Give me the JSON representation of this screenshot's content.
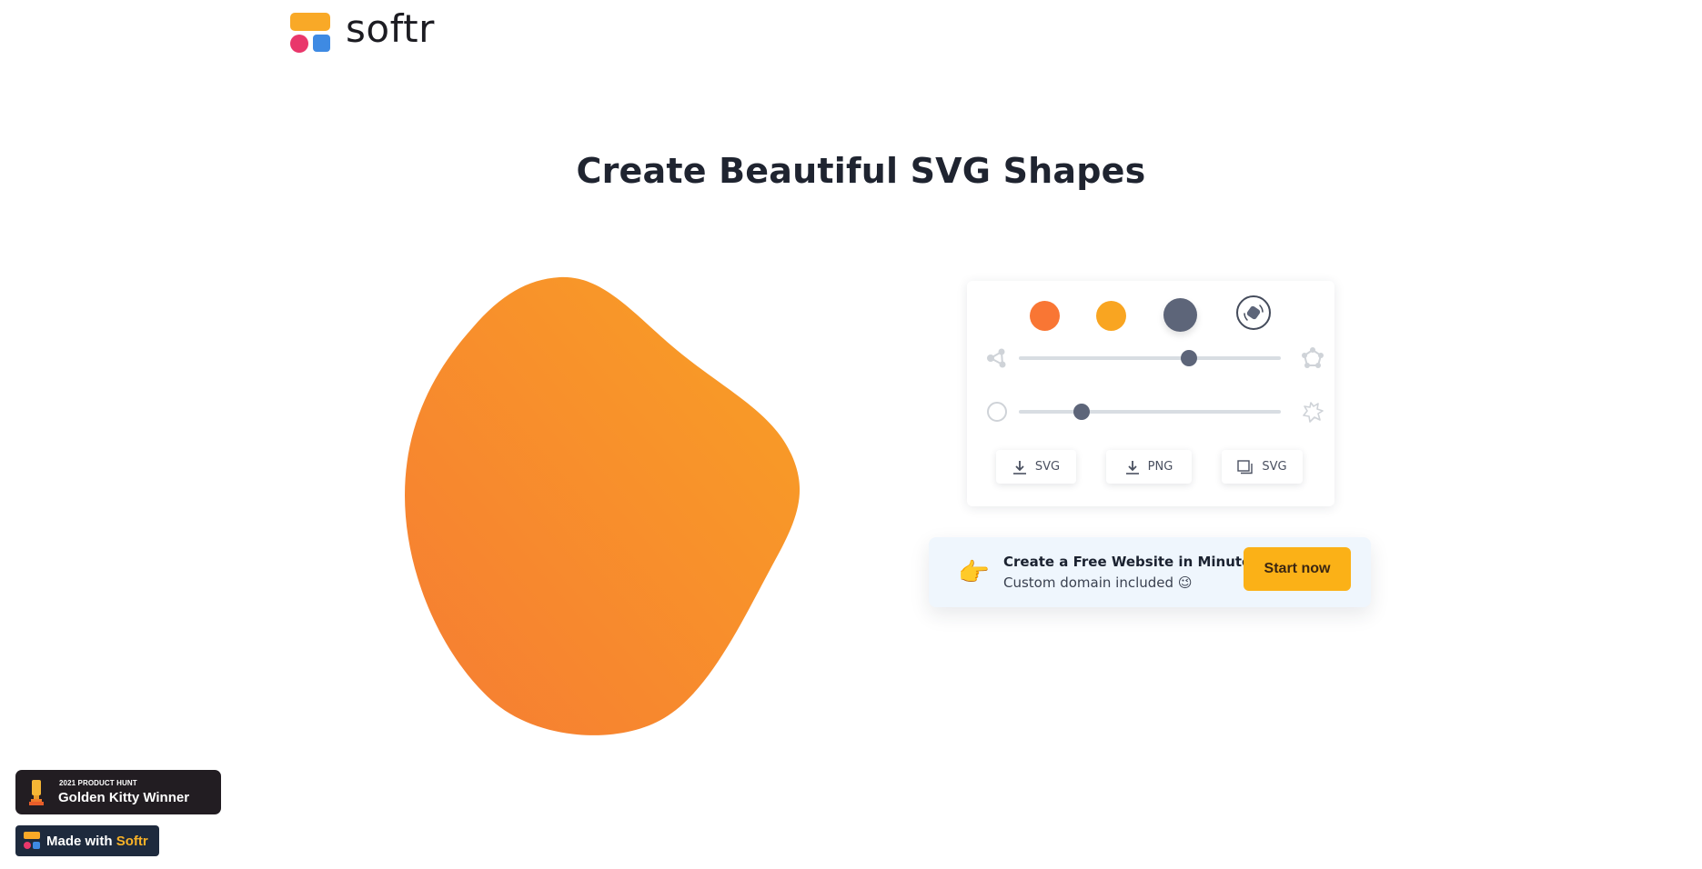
{
  "header": {
    "logo_text": "softr",
    "logo_colors": {
      "bar": "#f9a927",
      "dot": "#e9376b",
      "square": "#3e8ae3"
    }
  },
  "page": {
    "title": "Create Beautiful SVG Shapes"
  },
  "blob": {
    "gradient_start": "#f67c33",
    "gradient_end": "#f9a025"
  },
  "controls": {
    "color_swatches": [
      {
        "name": "orange",
        "color": "#f97634",
        "selected": false
      },
      {
        "name": "yellow",
        "color": "#f9a521",
        "selected": false
      },
      {
        "name": "slate",
        "color": "#5d6579",
        "selected": true
      }
    ],
    "random_icon": "dice-random-icon",
    "sliders": [
      {
        "name": "complexity",
        "left_icon": "triangle-nodes-icon",
        "right_icon": "pentagon-nodes-icon",
        "value": 0.65
      },
      {
        "name": "contrast",
        "left_icon": "circle-outline-icon",
        "right_icon": "splat-shape-icon",
        "value": 0.24
      }
    ],
    "buttons": [
      {
        "icon": "download-icon",
        "label": "SVG"
      },
      {
        "icon": "download-icon",
        "label": "PNG"
      },
      {
        "icon": "copy-icon",
        "label": "SVG"
      }
    ]
  },
  "cta": {
    "emoji": "👉",
    "title": "Create a Free Website in Minutes",
    "subtitle": "Custom domain included 😉",
    "button_label": "Start now",
    "button_color": "#fbb117"
  },
  "badges": {
    "product_hunt": {
      "small": "2021 PRODUCT HUNT",
      "big": "Golden Kitty Winner"
    },
    "made_with": {
      "prefix": "Made with",
      "brand": "Softr"
    }
  }
}
